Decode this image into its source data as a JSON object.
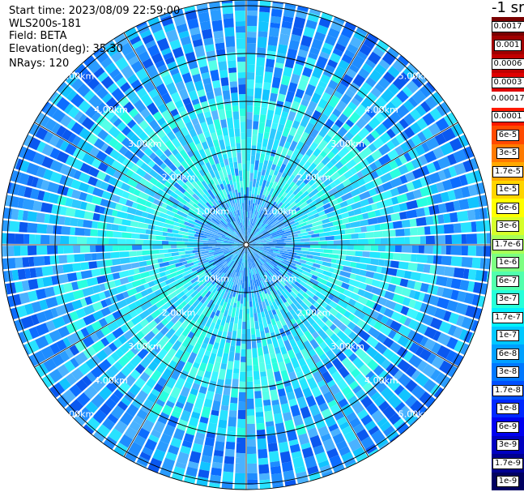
{
  "info": {
    "start_time": "Start time: 2023/08/09 22:59:00",
    "instrument": "WLS200s-181",
    "field": "Field: BETA",
    "elevation": "Elevation(deg): 35.30",
    "nrays": "NRays: 120"
  },
  "range_rings": {
    "labels": [
      "1.00km",
      "2.00km",
      "3.00km",
      "4.00km",
      "5.00km"
    ]
  },
  "colorbar": {
    "title": "-1 sr",
    "upper": [
      "0.0017",
      "0.001",
      "0.0006",
      "0.0003"
    ],
    "separator": "0.00017",
    "lower": [
      "0.0001",
      "6e-5",
      "3e-5",
      "1.7e-5",
      "1e-5",
      "6e-6",
      "3e-6",
      "1.7e-6",
      "1e-6",
      "6e-7",
      "3e-7",
      "1.7e-7",
      "1e-7",
      "6e-8",
      "3e-8",
      "1.7e-8",
      "1e-8",
      "6e-9",
      "3e-9",
      "1.7e-9",
      "1e-9"
    ],
    "upper_colors": [
      "#7a0000",
      "#a00000",
      "#c00000",
      "#e00000"
    ],
    "lower_colors": [
      "#ff1a00",
      "#ff4a00",
      "#ff7a00",
      "#ffa800",
      "#ffd500",
      "#ffff00",
      "#d6ff29",
      "#a8ff57",
      "#7dff82",
      "#52ffad",
      "#26ffd9",
      "#00f0ff",
      "#00c8ff",
      "#00a0ff",
      "#0078ff",
      "#0050ff",
      "#0028ff",
      "#0000f0",
      "#0000c0",
      "#000090",
      "#000060"
    ]
  }
}
